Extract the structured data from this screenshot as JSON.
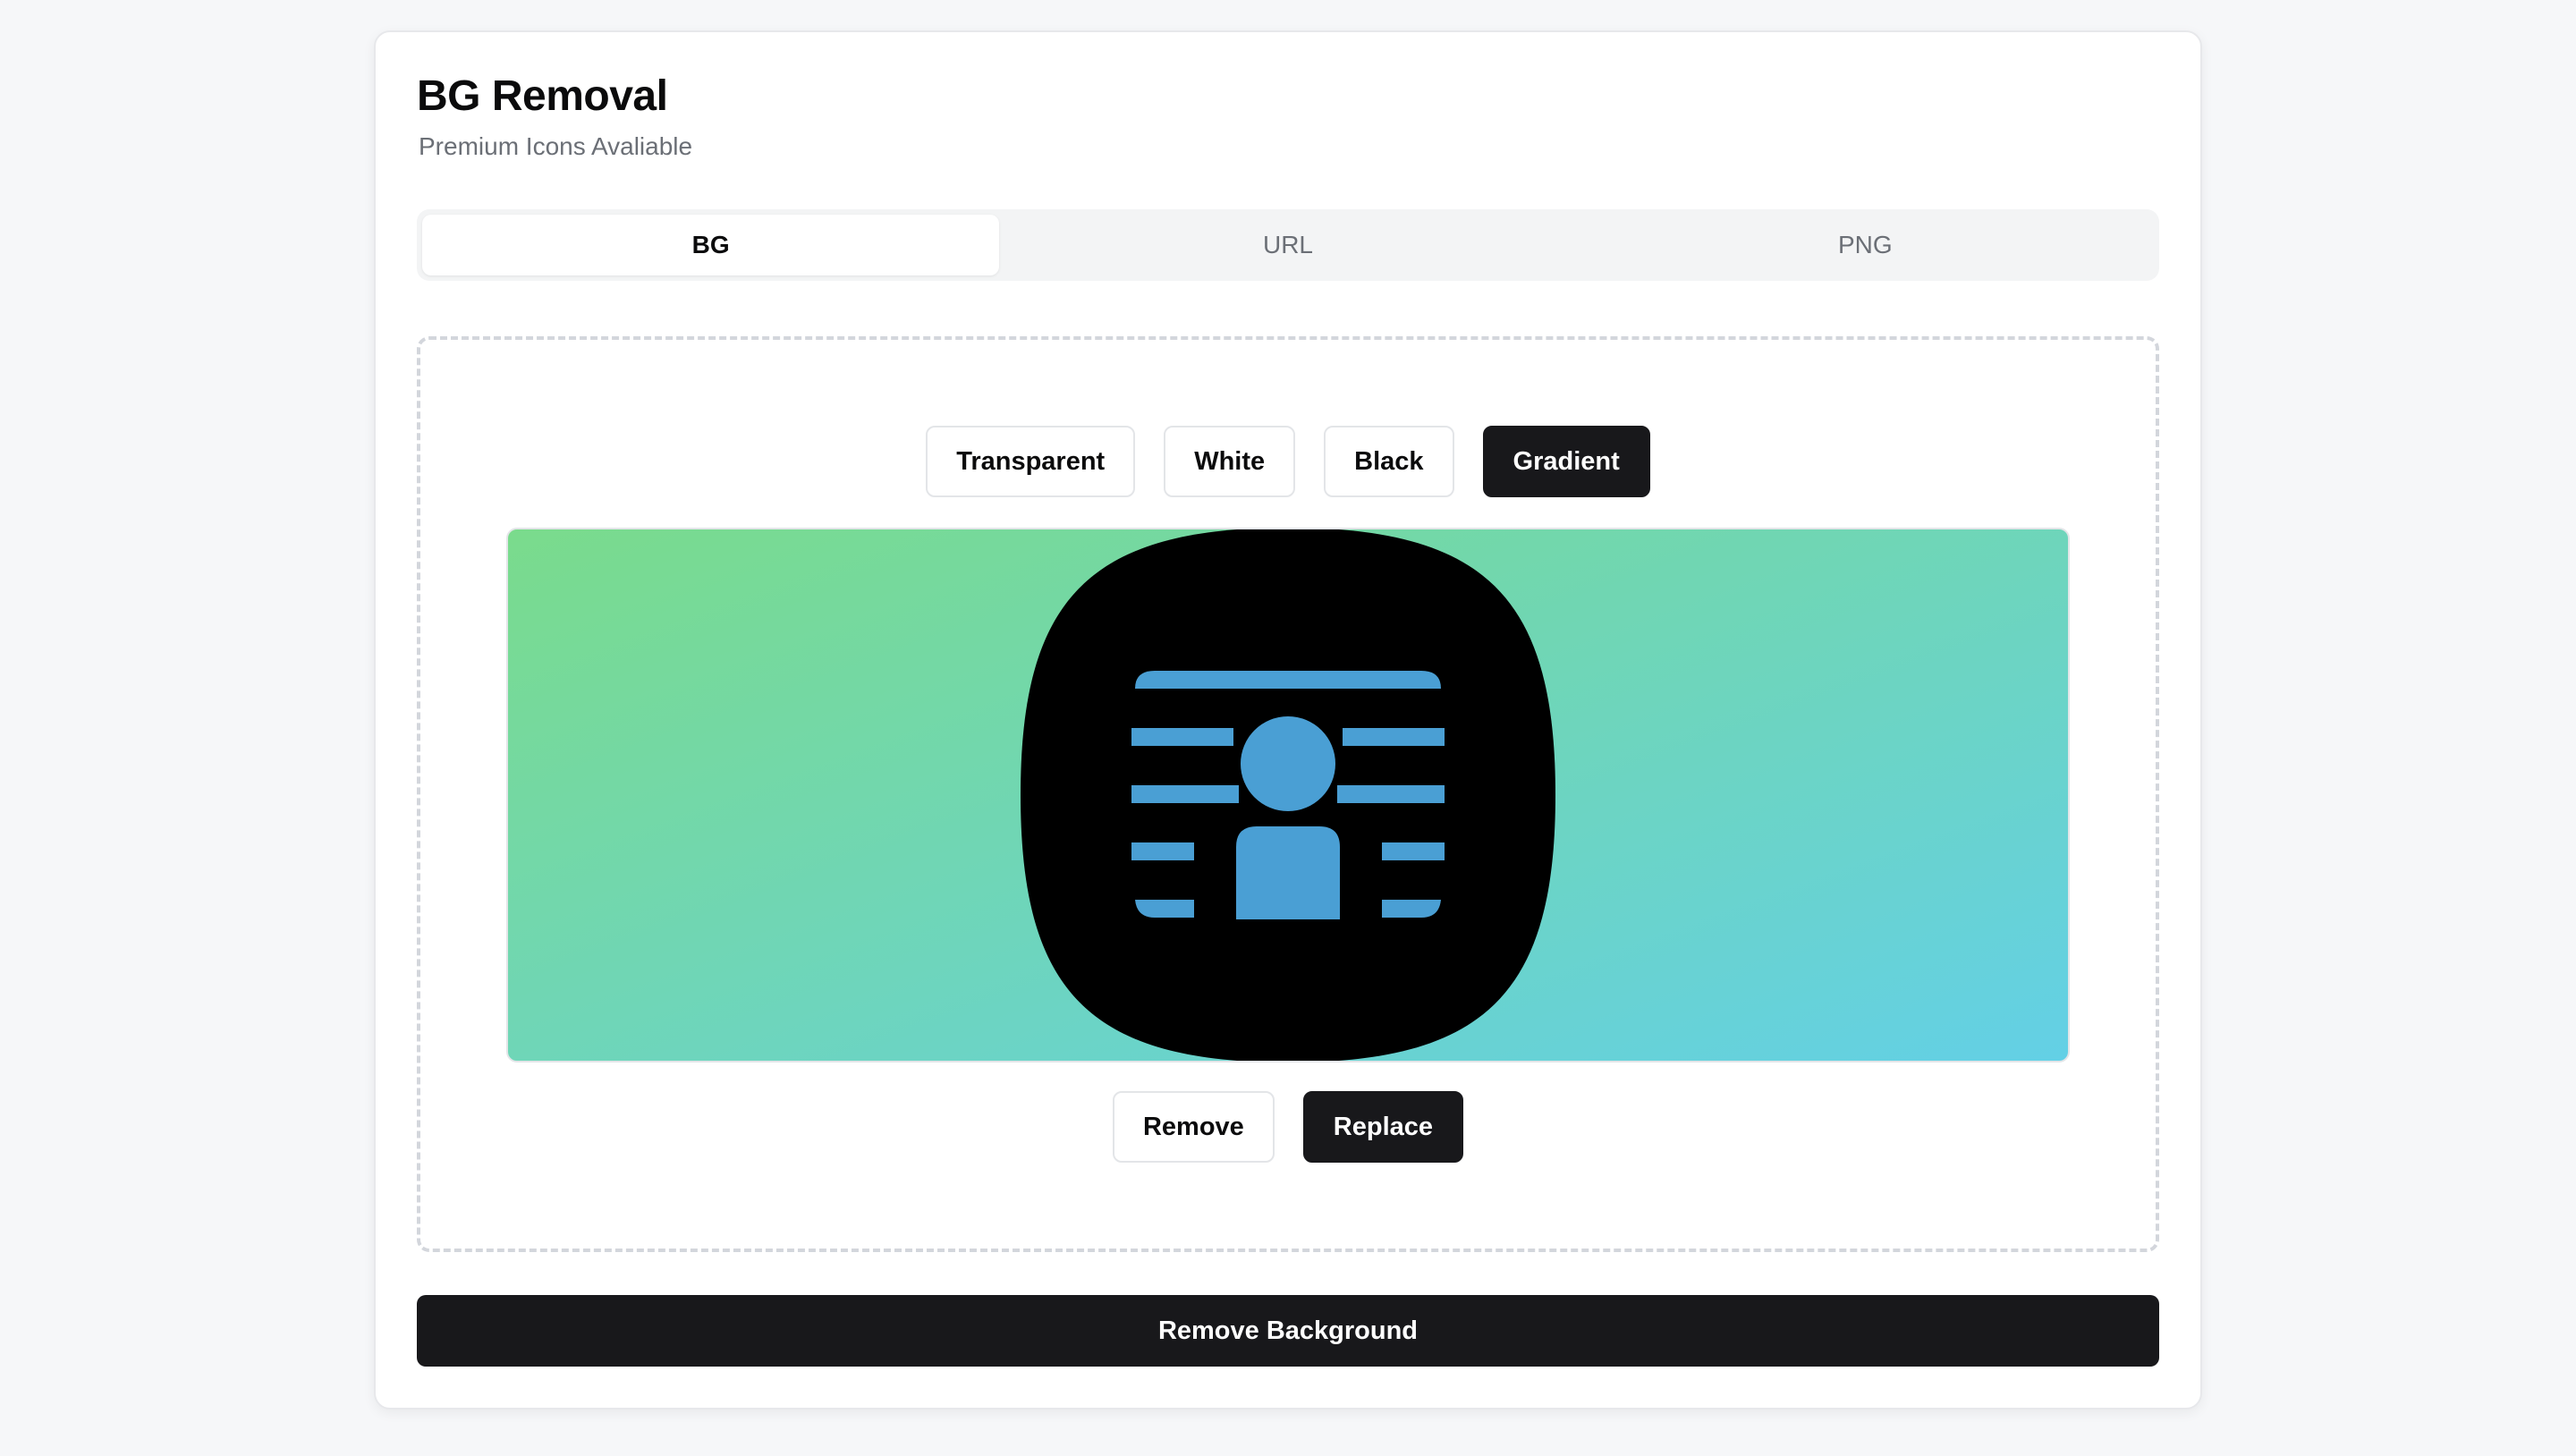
{
  "header": {
    "title": "BG Removal",
    "subtitle": "Premium Icons Avaliable"
  },
  "tabs": [
    {
      "label": "BG",
      "active": true
    },
    {
      "label": "URL",
      "active": false
    },
    {
      "label": "PNG",
      "active": false
    }
  ],
  "background_options": {
    "items": [
      "Transparent",
      "White",
      "Black",
      "Gradient"
    ],
    "selected": "Gradient"
  },
  "preview": {
    "gradient_from": "#7adb8c",
    "gradient_to": "#63d0e6",
    "icon": "person-id-icon",
    "icon_bg_color": "#000000",
    "icon_fg_color": "#4a9fd4"
  },
  "actions": {
    "remove_label": "Remove",
    "replace_label": "Replace"
  },
  "primary_action": {
    "label": "Remove Background"
  }
}
